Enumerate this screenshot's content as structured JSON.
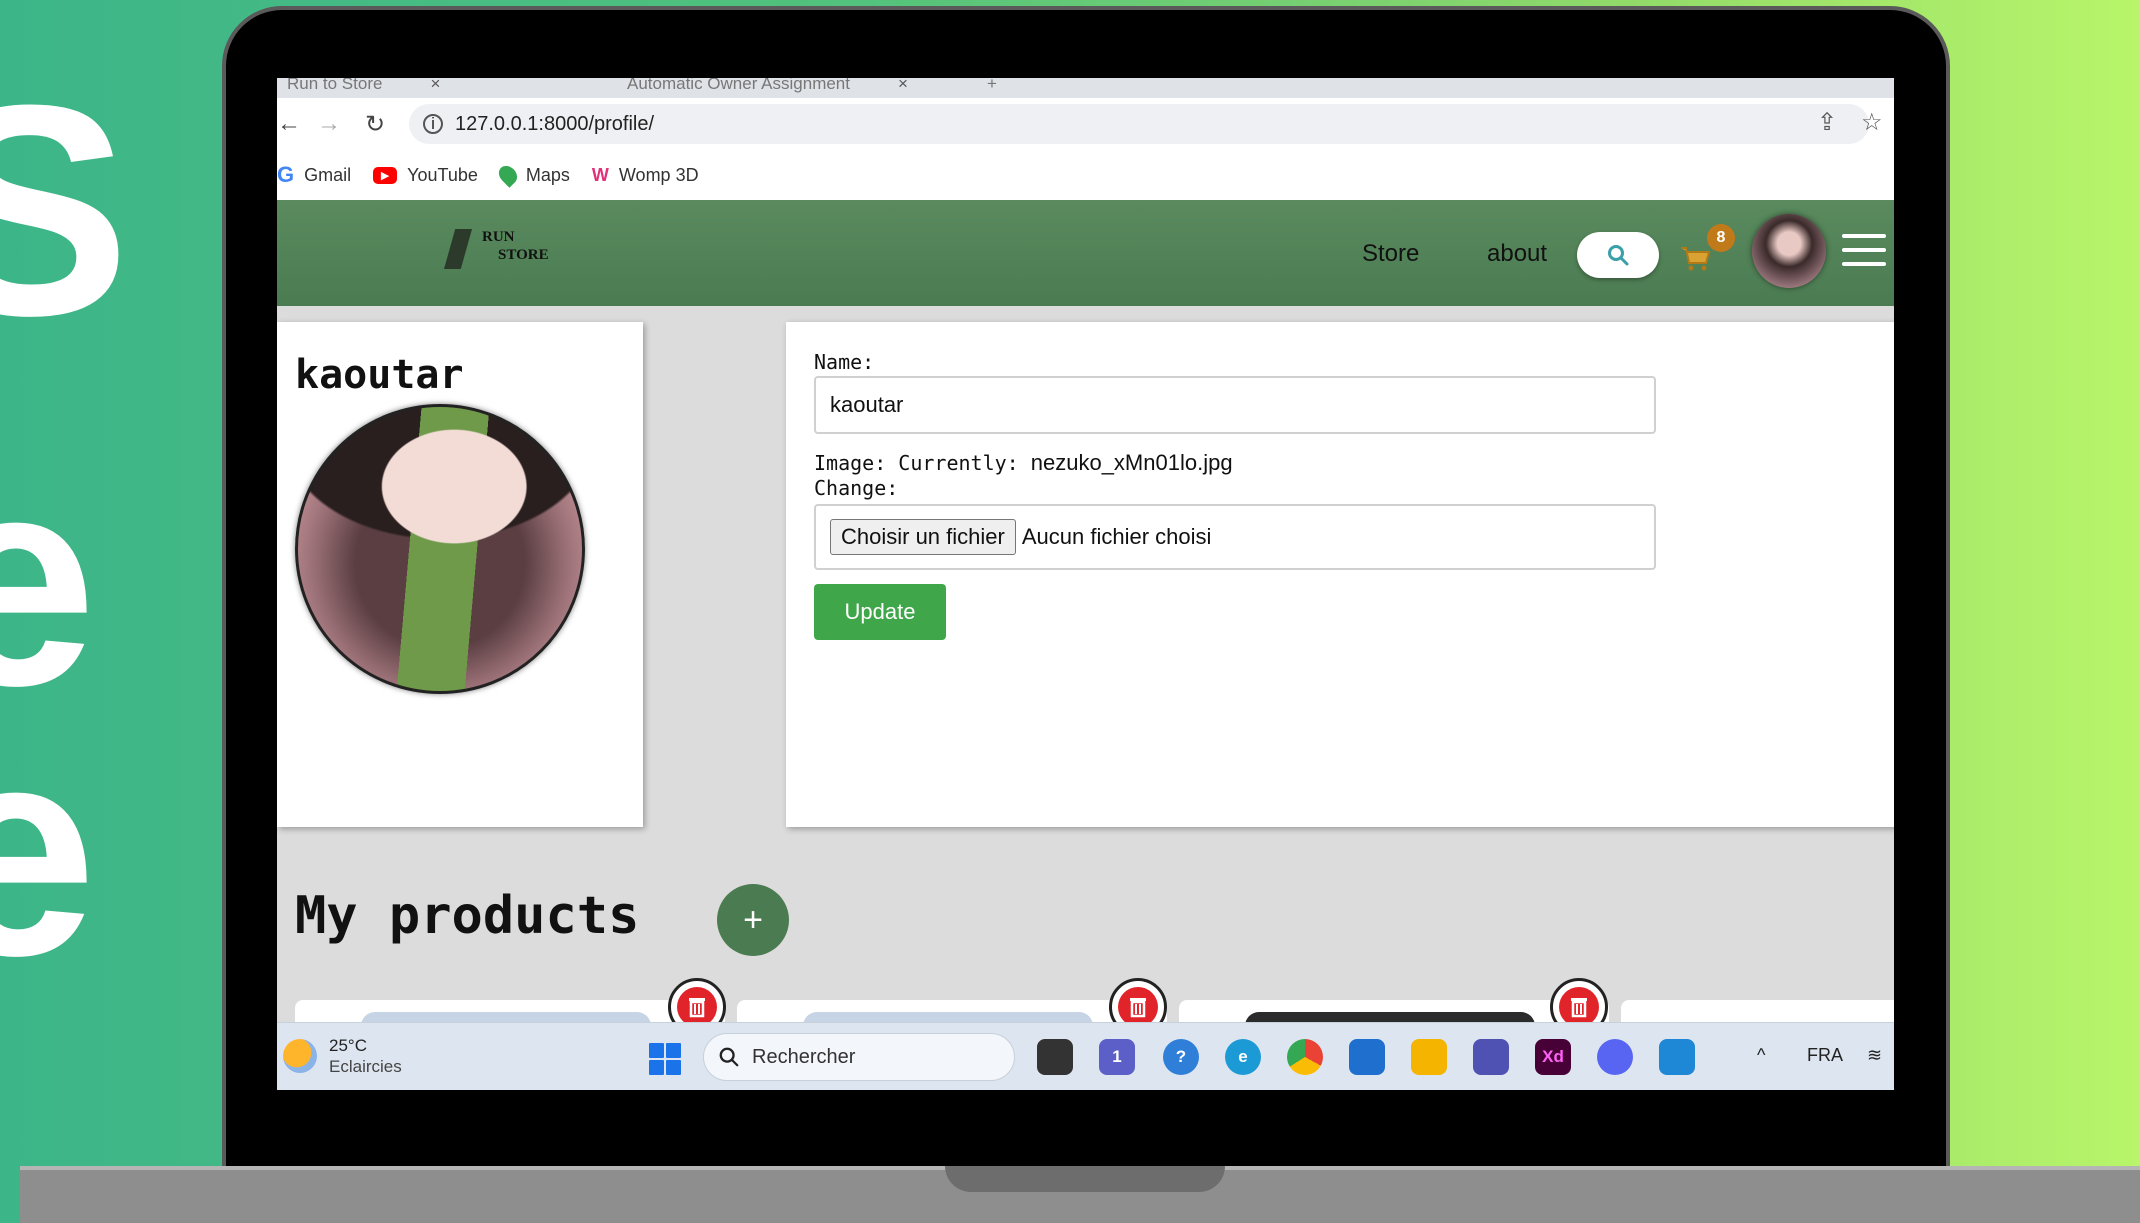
{
  "browser": {
    "tabs": [
      {
        "title": "Run to Store"
      },
      {
        "title": "Automatic Owner Assignment"
      }
    ],
    "new_tab": "+",
    "tab_close": "×",
    "url": "127.0.0.1:8000/profile/",
    "bookmarks": [
      {
        "label": "Gmail",
        "icon": "gmail-icon"
      },
      {
        "label": "YouTube",
        "icon": "youtube-icon"
      },
      {
        "label": "Maps",
        "icon": "maps-icon"
      },
      {
        "label": "Womp 3D",
        "icon": "womp-icon"
      }
    ]
  },
  "site": {
    "logo": {
      "line1": "RUN",
      "line2": "STORE"
    },
    "nav": {
      "store": "Store",
      "about": "about"
    },
    "cart_count": "8",
    "brand_color": "#4b7b51"
  },
  "profile": {
    "username": "kaoutar"
  },
  "form": {
    "name_label": "Name:",
    "name_value": "kaoutar",
    "image_label": "Image: Currently:",
    "image_current": "nezuko_xMn01lo.jpg",
    "change_label": "Change:",
    "file_button": "Choisir un fichier",
    "file_status": "Aucun fichier choisi",
    "update_button": "Update",
    "update_color": "#3fa64a"
  },
  "products": {
    "title": "My products",
    "add_label": "+"
  },
  "taskbar": {
    "temperature": "25°C",
    "weather": "Eclaircies",
    "search_placeholder": "Rechercher",
    "language": "FRA",
    "teams_badge": "1",
    "xd_label": "Xd"
  }
}
